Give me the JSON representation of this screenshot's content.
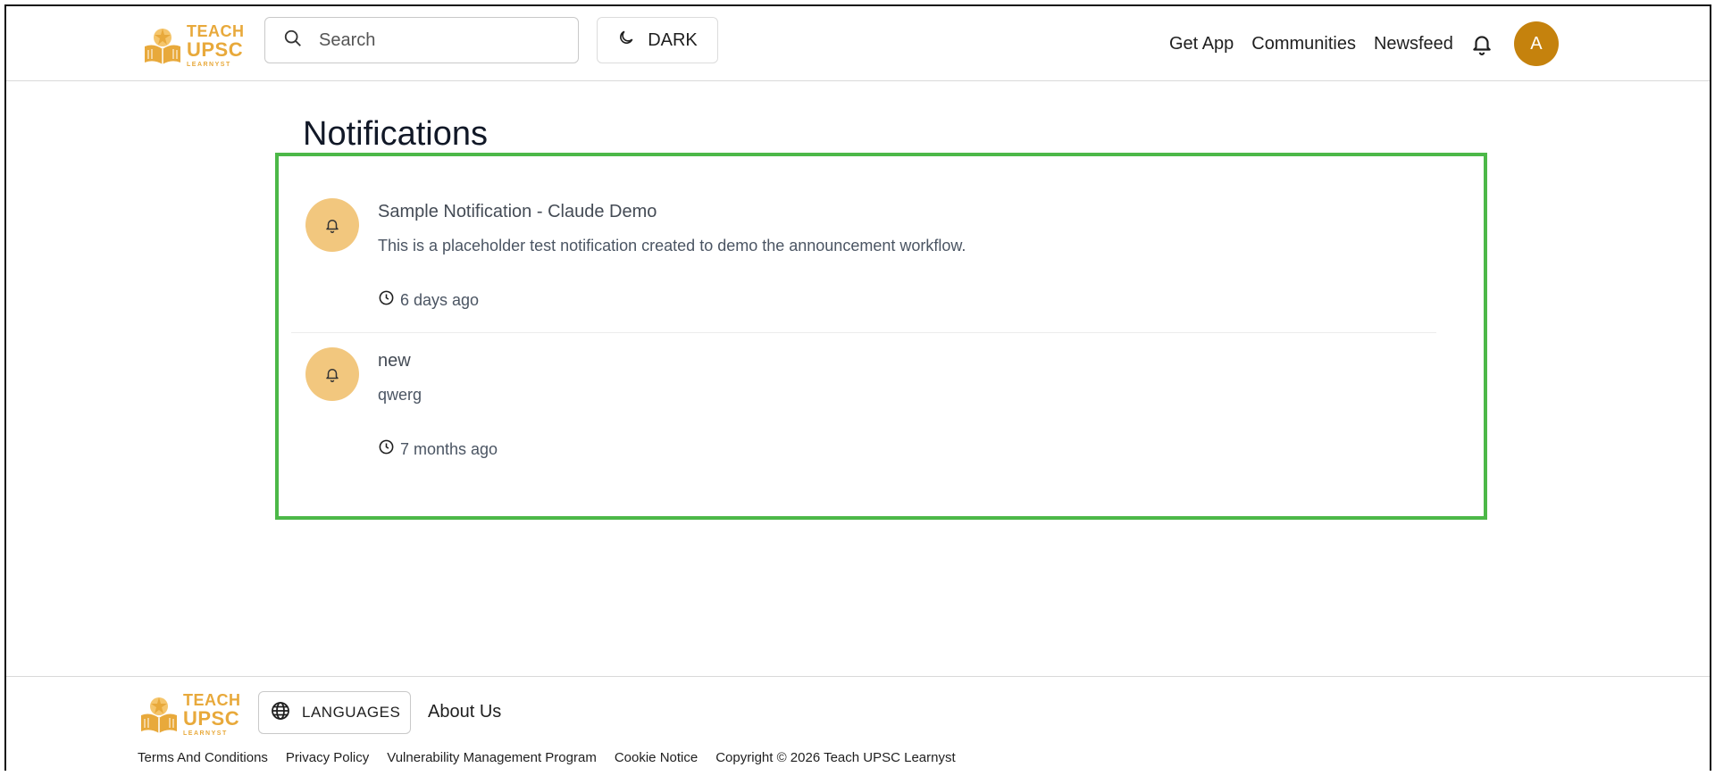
{
  "header": {
    "logo": {
      "line1": "TEACH",
      "line2": "UPSC",
      "line3": "LEARNYST"
    },
    "search": {
      "placeholder": "Search"
    },
    "theme_button": "DARK",
    "nav": [
      "Get App",
      "Communities",
      "Newsfeed"
    ],
    "avatar_initial": "A"
  },
  "page": {
    "title": "Notifications",
    "notifications": [
      {
        "title": "Sample Notification - Claude Demo",
        "body": "This is a placeholder test notification created to demo the announcement workflow.",
        "time": "6 days ago"
      },
      {
        "title": "new",
        "body": "qwerg",
        "time": "7 months ago"
      }
    ]
  },
  "footer": {
    "logo": {
      "line1": "TEACH",
      "line2": "UPSC",
      "line3": "LEARNYST"
    },
    "languages_button": "LANGUAGES",
    "about": "About Us",
    "links": [
      "Terms And Conditions",
      "Privacy Policy",
      "Vulnerability Management Program",
      "Cookie Notice",
      "Copyright © 2026 Teach UPSC Learnyst"
    ]
  },
  "colors": {
    "brand": "#e8a93b",
    "avatar": "#c5820d",
    "notif_icon_bg": "#f2c77e",
    "highlight_border": "#4cb848"
  }
}
